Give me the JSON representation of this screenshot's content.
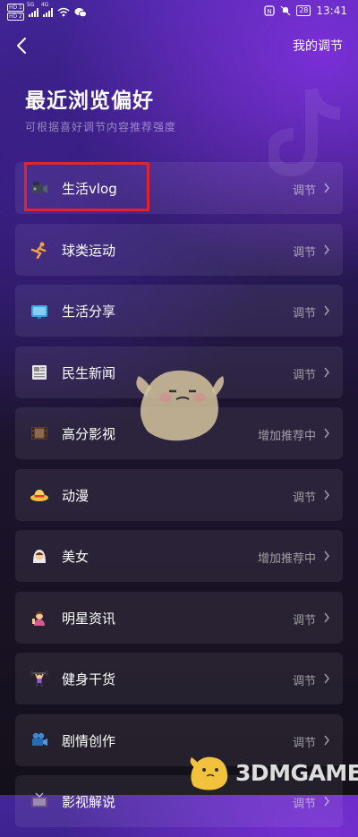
{
  "status_bar": {
    "hd1": "HD 1",
    "hd2": "HD 2",
    "net1": "5G",
    "net2": "4G",
    "battery": "28",
    "time": "13:41"
  },
  "nav": {
    "right_label": "我的调节"
  },
  "header": {
    "title": "最近浏览偏好",
    "subtitle": "可根据喜好调节内容推荐强度"
  },
  "items": [
    {
      "label": "生活vlog",
      "status": "调节",
      "icon": "video-camera-icon"
    },
    {
      "label": "球类运动",
      "status": "调节",
      "icon": "ball-sport-icon"
    },
    {
      "label": "生活分享",
      "status": "调节",
      "icon": "tv-share-icon"
    },
    {
      "label": "民生新闻",
      "status": "调节",
      "icon": "newspaper-icon"
    },
    {
      "label": "高分影视",
      "status": "增加推荐中",
      "icon": "film-strip-icon"
    },
    {
      "label": "动漫",
      "status": "调节",
      "icon": "straw-hat-icon"
    },
    {
      "label": "美女",
      "status": "增加推荐中",
      "icon": "woman-icon"
    },
    {
      "label": "明星资讯",
      "status": "调节",
      "icon": "celebrity-icon"
    },
    {
      "label": "健身干货",
      "status": "调节",
      "icon": "weightlifter-icon"
    },
    {
      "label": "剧情创作",
      "status": "调节",
      "icon": "movie-camera-icon"
    },
    {
      "label": "影视解说",
      "status": "调节",
      "icon": "tv-icon"
    }
  ],
  "watermark": {
    "text": "3DMGAME"
  },
  "colors": {
    "highlight": "#e0232c",
    "background_top": "#4a2aa8",
    "background_bottom": "#141019"
  }
}
